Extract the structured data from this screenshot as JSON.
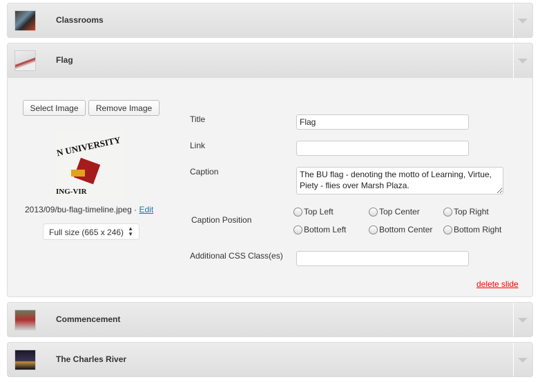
{
  "slides": [
    {
      "title": "Classrooms",
      "thumb_icon": "classroom-photo"
    },
    {
      "title": "Flag",
      "thumb_icon": "flag-photo"
    },
    {
      "title": "Commencement",
      "thumb_icon": "commencement-photo"
    },
    {
      "title": "The Charles River",
      "thumb_icon": "river-night-photo"
    }
  ],
  "editor": {
    "select_image": "Select Image",
    "remove_image": "Remove Image",
    "file_path": "2013/09/bu-flag-timeline.jpeg",
    "separator": "·",
    "edit_link": "Edit",
    "size_select": "Full size (665 x 246)",
    "title_label": "Title",
    "title_value": "Flag",
    "link_label": "Link",
    "link_value": "",
    "caption_label": "Caption",
    "caption_value": "The BU flag - denoting the motto of Learning, Virtue, Piety - flies over Marsh Plaza.",
    "caption_position_label": "Caption Position",
    "positions": [
      "Top Left",
      "Top Center",
      "Top Right",
      "Bottom Left",
      "Bottom Center",
      "Bottom Right"
    ],
    "css_label": "Additional CSS Class(es)",
    "css_value": "",
    "delete_slide": "delete slide",
    "delete_color": "#ff0000"
  }
}
